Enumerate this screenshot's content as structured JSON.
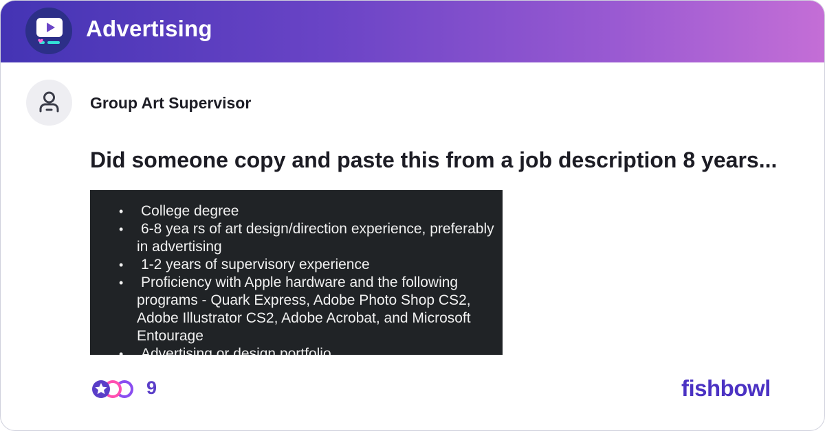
{
  "header": {
    "channel_name": "Advertising",
    "logo_icon": "bowl-video-icon",
    "gradient_colors": [
      "#4434b4",
      "#c46ed6"
    ]
  },
  "post": {
    "author_title": "Group Art Supervisor",
    "avatar_icon": "person-icon",
    "title": "Did someone copy and paste this from a job description 8 years...",
    "attachment": {
      "bullets": [
        "College degree",
        "6-8 yea rs of art design/direction experience, preferably in advertising",
        "1-2 years of supervisory experience",
        "Proficiency with Apple hardware and the following programs - Quark Express, Adobe Photo Shop CS2, Adobe Illustrator CS2, Adobe Acrobat, and Microsoft Entourage",
        "Advertising or design portfolio"
      ]
    }
  },
  "footer": {
    "reaction_count": "9",
    "brand": "fishbowl",
    "accent_color": "#4b32c3"
  }
}
